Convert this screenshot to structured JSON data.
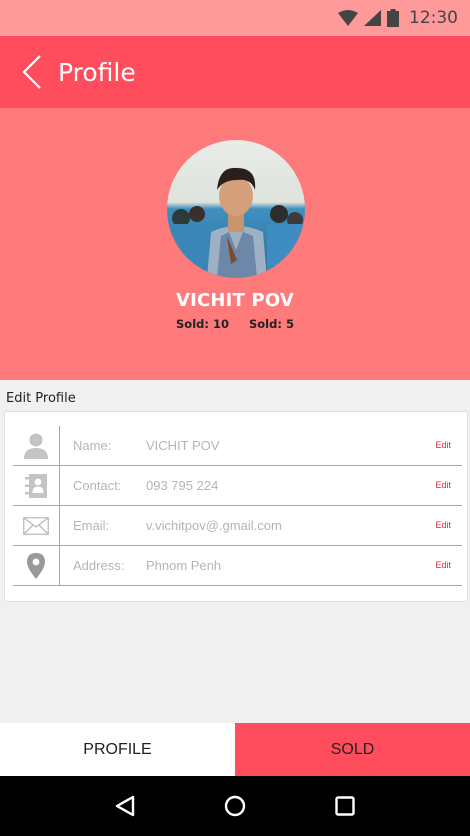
{
  "status_bar": {
    "time": "12:30"
  },
  "app_bar": {
    "title": "Profile"
  },
  "profile": {
    "name": "VICHIT POV",
    "stats": [
      "Sold: 10",
      "Sold: 5"
    ]
  },
  "edit_section": {
    "title": "Edit Profile",
    "rows": [
      {
        "label": "Name:",
        "value": "VICHIT POV",
        "action": "Edit",
        "icon": "person-icon"
      },
      {
        "label": "Contact:",
        "value": "093 795 224",
        "action": "Edit",
        "icon": "contact-book-icon"
      },
      {
        "label": "Email:",
        "value": "v.vichitpov@.gmail.com",
        "action": "Edit",
        "icon": "envelope-icon"
      },
      {
        "label": "Address:",
        "value": "Phnom Penh",
        "action": "Edit",
        "icon": "location-pin-icon"
      }
    ]
  },
  "bottom_tabs": {
    "profile_label": "PROFILE",
    "sold_label": "SOLD"
  },
  "colors": {
    "primary": "#ff4d5e",
    "hero": "#ff7b7b",
    "status_bar": "#ff9a9a",
    "edit_link": "#e0283a"
  }
}
